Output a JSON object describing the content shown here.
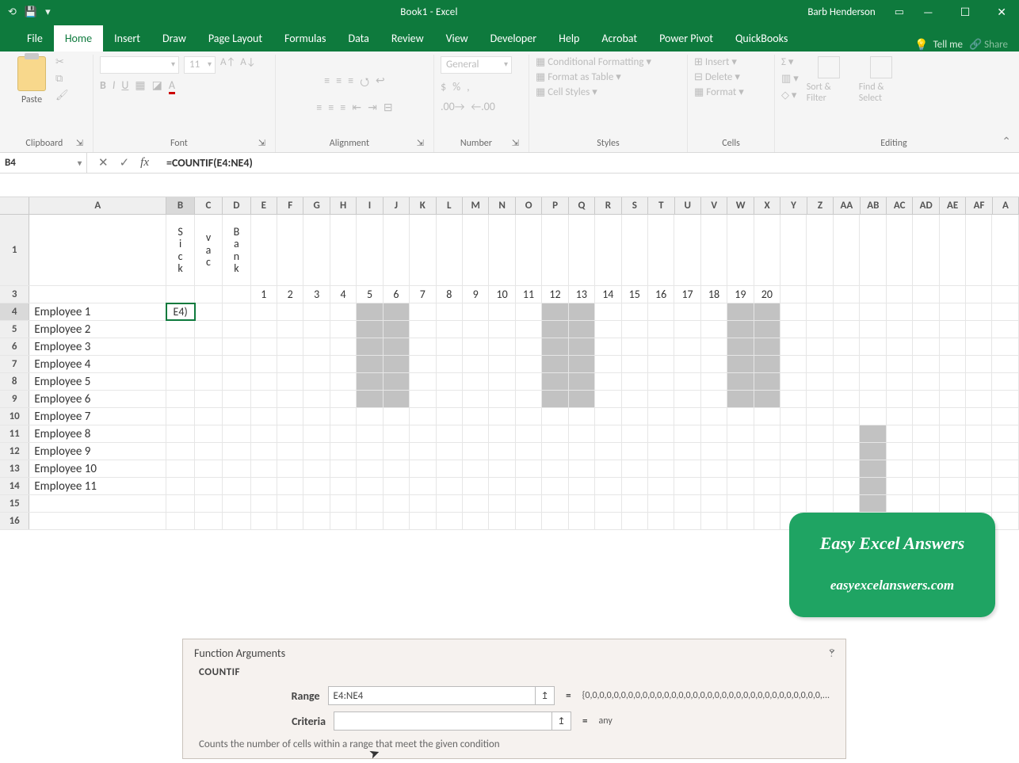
{
  "title_bar": {
    "document": "Book1 - Excel",
    "user": "Barb Henderson"
  },
  "tabs": {
    "file": "File",
    "home": "Home",
    "insert": "Insert",
    "draw": "Draw",
    "pagelayout": "Page Layout",
    "formulas": "Formulas",
    "data": "Data",
    "review": "Review",
    "view": "View",
    "developer": "Developer",
    "help": "Help",
    "acrobat": "Acrobat",
    "powerpivot": "Power Pivot",
    "quickbooks": "QuickBooks",
    "tellme": "Tell me",
    "share": "Share"
  },
  "ribbon": {
    "clipboard": {
      "label": "Clipboard",
      "paste": "Paste"
    },
    "font": {
      "label": "Font",
      "size": "11"
    },
    "alignment": {
      "label": "Alignment"
    },
    "number": {
      "label": "Number",
      "format": "General"
    },
    "styles": {
      "label": "Styles",
      "cond": "Conditional Formatting",
      "table": "Format as Table",
      "cell": "Cell Styles"
    },
    "cells": {
      "label": "Cells",
      "insert": "Insert",
      "delete": "Delete",
      "format": "Format"
    },
    "editing": {
      "label": "Editing",
      "sort": "Sort & Filter",
      "find": "Find & Select"
    }
  },
  "namebox": "B4",
  "formula": "=COUNTIF(E4:NE4)",
  "active_cell_display": "E4)",
  "col_headers": [
    "A",
    "B",
    "C",
    "D",
    "E",
    "F",
    "G",
    "H",
    "I",
    "J",
    "K",
    "L",
    "M",
    "N",
    "O",
    "P",
    "Q",
    "R",
    "S",
    "T",
    "U",
    "V",
    "W",
    "X",
    "Y",
    "Z",
    "AA",
    "AB",
    "AC",
    "AD",
    "AE",
    "AF",
    "A"
  ],
  "row1": {
    "B": "S\ni\nc\nk",
    "C": "v\na\nc",
    "D": "B\na\nn\nk"
  },
  "row3_dates": [
    "1",
    "2",
    "3",
    "4",
    "5",
    "6",
    "7",
    "8",
    "9",
    "10",
    "11",
    "12",
    "13",
    "14",
    "15",
    "16",
    "17",
    "18",
    "19",
    "20"
  ],
  "employees": [
    "Employee 1",
    "Employee 2",
    "Employee 3",
    "Employee 4",
    "Employee 5",
    "Employee 6",
    "Employee 7",
    "Employee 8",
    "Employee 9",
    "Employee 10",
    "Employee 11"
  ],
  "row_indices": [
    "1",
    "3",
    "4",
    "5",
    "6",
    "7",
    "8",
    "9",
    "10",
    "11",
    "12",
    "13",
    "14",
    "15",
    "16"
  ],
  "grey_bands": [
    [
      5,
      6
    ],
    [
      12,
      13
    ],
    [
      19,
      20
    ]
  ],
  "watermark": {
    "title": "Easy Excel Answers",
    "url": "easyexcelanswers.com"
  },
  "dialog": {
    "title": "Function Arguments",
    "fn": "COUNTIF",
    "range_label": "Range",
    "range_value": "E4:NE4",
    "range_result": "{0,0,0,0,0,0,0,0,0,0,0,0,0,0,0,0,0,0,0,0,0,0,0,0,0,0,0,0,0,0,0,0,0,...",
    "criteria_label": "Criteria",
    "criteria_value": "",
    "criteria_result": "any",
    "desc": "Counts the number of cells within a range that meet the given condition"
  }
}
